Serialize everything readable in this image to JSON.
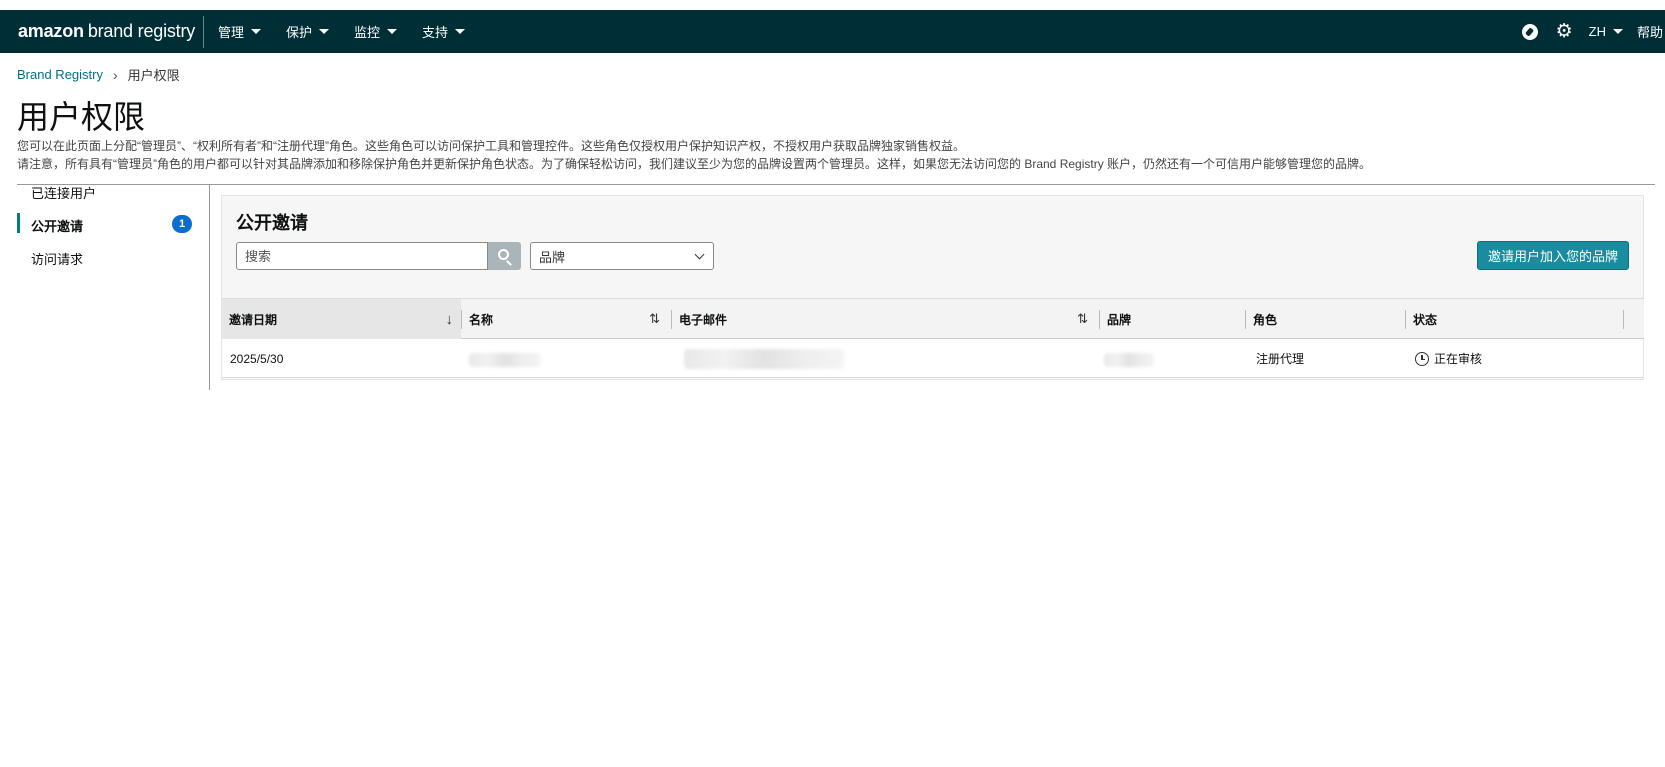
{
  "topbar": {
    "logo_amazon": "amazon",
    "logo_brand": "brand registry",
    "nav": [
      "管理",
      "保护",
      "监控",
      "支持"
    ],
    "language": "ZH",
    "help": "帮助"
  },
  "breadcrumb": {
    "root": "Brand Registry",
    "separator": "›",
    "current": "用户权限"
  },
  "page": {
    "title": "用户权限",
    "description_1": "您可以在此页面上分配“管理员”、“权利所有者”和“注册代理”角色。这些角色可以访问保护工具和管理控件。这些角色仅授权用户保护知识产权，不授权用户获取品牌独家销售权益。",
    "description_2": "请注意，所有具有“管理员”角色的用户都可以针对其品牌添加和移除保护角色并更新保护角色状态。为了确保轻松访问，我们建议至少为您的品牌设置两个管理员。这样，如果您无法访问您的 Brand Registry 账户，仍然还有一个可信用户能够管理您的品牌。"
  },
  "sidebar": {
    "items": [
      {
        "label": "已连接用户",
        "active": false
      },
      {
        "label": "公开邀请",
        "active": true,
        "badge": "1"
      },
      {
        "label": "访问请求",
        "active": false
      }
    ]
  },
  "panel": {
    "title": "公开邀请",
    "search_placeholder": "搜索",
    "brand_select": "品牌",
    "invite_button": "邀请用户加入您的品牌"
  },
  "table": {
    "headers": [
      "邀请日期",
      "名称",
      "电子邮件",
      "品牌",
      "角色",
      "状态"
    ],
    "rows": [
      {
        "date": "2025/5/30",
        "name": "",
        "email": "",
        "brand": "",
        "role": "注册代理",
        "status": "正在审核"
      }
    ]
  },
  "colors": {
    "topbar_bg": "#002e36",
    "link": "#007185",
    "primary_button": "#1a8c9f",
    "badge": "#0a6ed1"
  }
}
